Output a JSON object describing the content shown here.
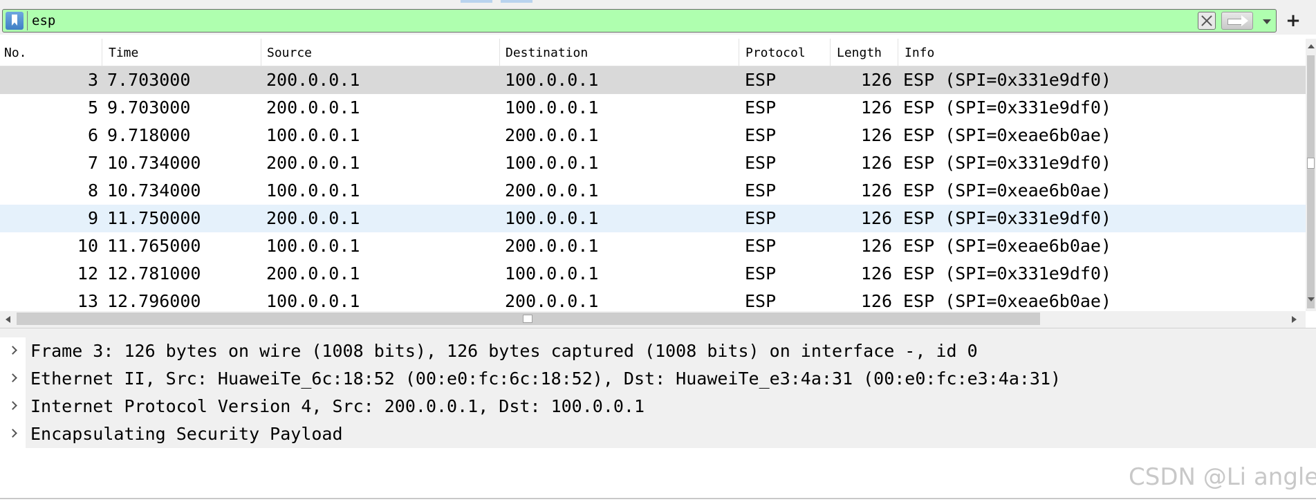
{
  "filter": {
    "value": "esp",
    "bookmark_icon": "bookmark-icon",
    "clear_icon": "clear-icon",
    "apply_icon": "arrow-right-icon",
    "dropdown_icon": "chevron-down-icon",
    "add_label": "+",
    "background_color": "#afffaf"
  },
  "packet_list": {
    "columns": [
      "No.",
      "Time",
      "Source",
      "Destination",
      "Protocol",
      "Length",
      "Info"
    ],
    "selected_row_color": "#d9d9d9",
    "hover_row_color": "#e5f1fb",
    "rows": [
      {
        "no": "3",
        "time": "7.703000",
        "source": "200.0.0.1",
        "destination": "100.0.0.1",
        "protocol": "ESP",
        "length": "126",
        "info": "ESP (SPI=0x331e9df0)"
      },
      {
        "no": "5",
        "time": "9.703000",
        "source": "200.0.0.1",
        "destination": "100.0.0.1",
        "protocol": "ESP",
        "length": "126",
        "info": "ESP (SPI=0x331e9df0)"
      },
      {
        "no": "6",
        "time": "9.718000",
        "source": "100.0.0.1",
        "destination": "200.0.0.1",
        "protocol": "ESP",
        "length": "126",
        "info": "ESP (SPI=0xeae6b0ae)"
      },
      {
        "no": "7",
        "time": "10.734000",
        "source": "200.0.0.1",
        "destination": "100.0.0.1",
        "protocol": "ESP",
        "length": "126",
        "info": "ESP (SPI=0x331e9df0)"
      },
      {
        "no": "8",
        "time": "10.734000",
        "source": "100.0.0.1",
        "destination": "200.0.0.1",
        "protocol": "ESP",
        "length": "126",
        "info": "ESP (SPI=0xeae6b0ae)"
      },
      {
        "no": "9",
        "time": "11.750000",
        "source": "200.0.0.1",
        "destination": "100.0.0.1",
        "protocol": "ESP",
        "length": "126",
        "info": "ESP (SPI=0x331e9df0)"
      },
      {
        "no": "10",
        "time": "11.765000",
        "source": "100.0.0.1",
        "destination": "200.0.0.1",
        "protocol": "ESP",
        "length": "126",
        "info": "ESP (SPI=0xeae6b0ae)"
      },
      {
        "no": "12",
        "time": "12.781000",
        "source": "200.0.0.1",
        "destination": "100.0.0.1",
        "protocol": "ESP",
        "length": "126",
        "info": "ESP (SPI=0x331e9df0)"
      },
      {
        "no": "13",
        "time": "12.796000",
        "source": "100.0.0.1",
        "destination": "200.0.0.1",
        "protocol": "ESP",
        "length": "126",
        "info": "ESP (SPI=0xeae6b0ae)"
      }
    ]
  },
  "details": {
    "items": [
      "Frame 3: 126 bytes on wire (1008 bits), 126 bytes captured (1008 bits) on interface -, id 0",
      "Ethernet II, Src: HuaweiTe_6c:18:52 (00:e0:fc:6c:18:52), Dst: HuaweiTe_e3:4a:31 (00:e0:fc:e3:4a:31)",
      "Internet Protocol Version 4, Src: 200.0.0.1, Dst: 100.0.0.1",
      "Encapsulating Security Payload"
    ]
  },
  "watermark": "CSDN @Li angle"
}
